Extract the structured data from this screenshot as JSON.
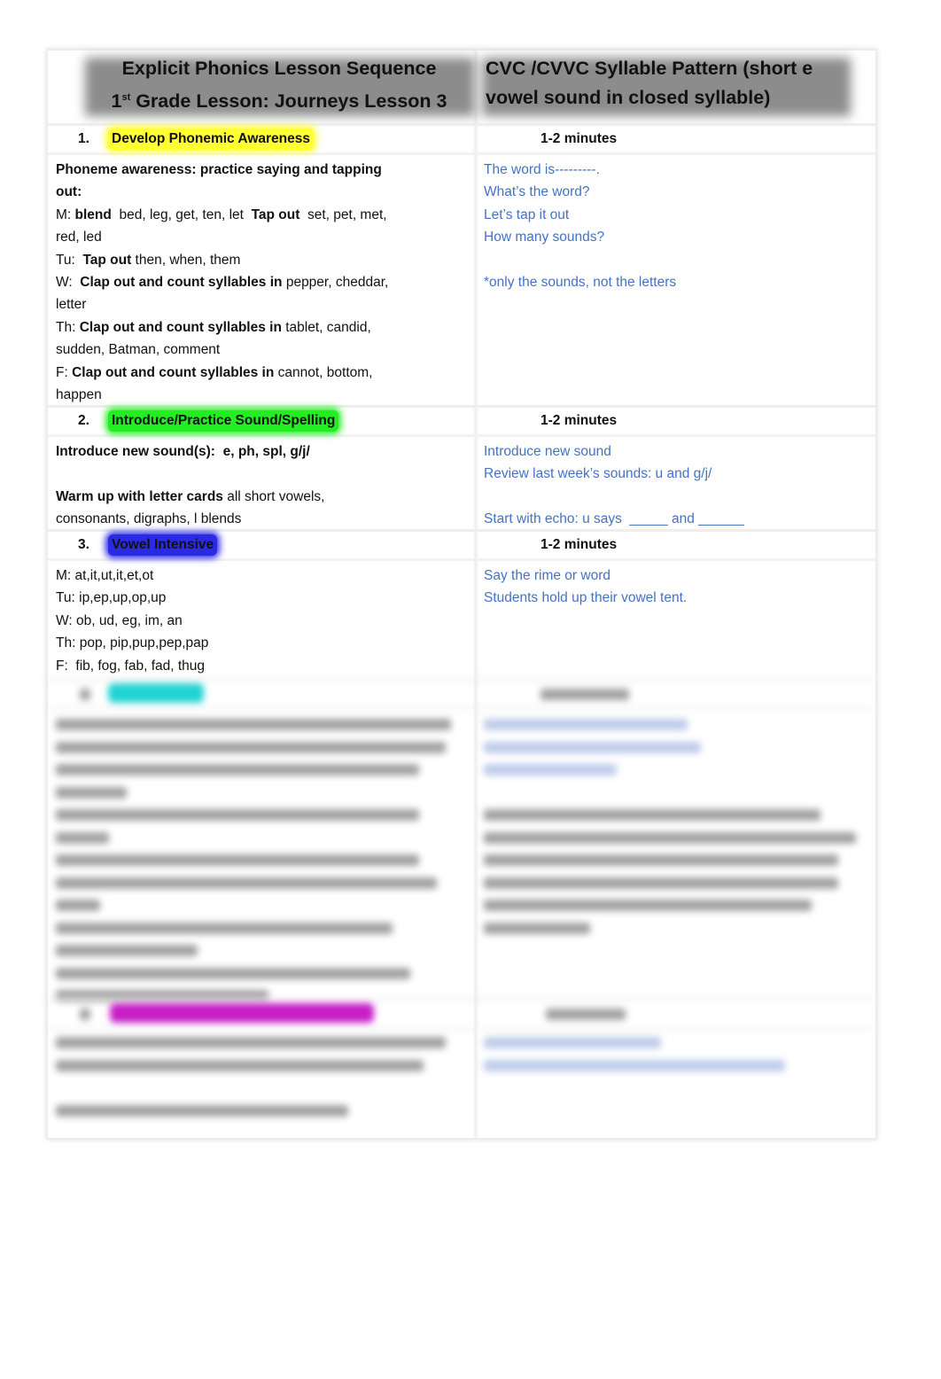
{
  "header": {
    "left_line1": "Explicit Phonics Lesson Sequence",
    "left_line2_num": "1",
    "left_line2_sup": "st",
    "left_line2_rest": " Grade Lesson: Journeys Lesson 3",
    "right_line1": "CVC /CVVC Syllable Pattern (short e",
    "right_line2": "vowel sound in closed syllable)"
  },
  "sections": [
    {
      "number": "1.",
      "title": "Develop Phonemic Awareness",
      "highlight": "#ffff33",
      "time": "1-2 minutes",
      "left_lines": [
        [
          {
            "t": "Phoneme awareness: practice saying and tapping",
            "b": true
          }
        ],
        [
          {
            "t": "out:",
            "b": true
          }
        ],
        [
          {
            "t": "M: "
          },
          {
            "t": "blend",
            "b": true
          },
          {
            "t": "  bed, leg, get, ten, let  "
          },
          {
            "t": "Tap out",
            "b": true
          },
          {
            "t": "  set, pet, met,"
          }
        ],
        [
          {
            "t": "red, led"
          }
        ],
        [
          {
            "t": "Tu:  "
          },
          {
            "t": "Tap out",
            "b": true
          },
          {
            "t": " then, when, them"
          }
        ],
        [
          {
            "t": "W:  "
          },
          {
            "t": "Clap out and count syllables in",
            "b": true
          },
          {
            "t": " pepper, cheddar,"
          }
        ],
        [
          {
            "t": "letter"
          }
        ],
        [
          {
            "t": "Th: "
          },
          {
            "t": "Clap out and count syllables in",
            "b": true
          },
          {
            "t": " tablet, candid,"
          }
        ],
        [
          {
            "t": "sudden, Batman, comment"
          }
        ],
        [
          {
            "t": "F: "
          },
          {
            "t": "Clap out and count syllables in",
            "b": true
          },
          {
            "t": " cannot, bottom,"
          }
        ],
        [
          {
            "t": "happen"
          }
        ]
      ],
      "right_lines": [
        "The word is---------.",
        "What’s the word?",
        "Let’s tap it out",
        "How many sounds?",
        "",
        "*only the sounds, not the letters"
      ]
    },
    {
      "number": "2.",
      "title": "Introduce/Practice Sound/Spelling",
      "highlight": "#22ee22",
      "time": "1-2 minutes",
      "left_lines": [
        [
          {
            "t": "Introduce new sound(s):  e, ph, spl, g/j/",
            "b": true
          }
        ],
        [],
        [
          {
            "t": "Warm up with letter cards",
            "b": true
          },
          {
            "t": " all short vowels,"
          }
        ],
        [
          {
            "t": "consonants, digraphs, l blends"
          }
        ]
      ],
      "right_lines": [
        "Introduce new sound",
        "Review last week’s sounds: u and g/j/",
        "",
        "Start with echo: u says  _____ and ______"
      ]
    },
    {
      "number": "3.",
      "title": "Vowel Intensive",
      "highlight": "#2a2ae6",
      "time": "1-2 minutes",
      "left_lines": [
        [
          {
            "t": "M: at,it,ut,it,et,ot"
          }
        ],
        [
          {
            "t": "Tu: ip,ep,up,op,up"
          }
        ],
        [
          {
            "t": "W: ob, ud, eg, im, an"
          }
        ],
        [
          {
            "t": "Th: pop, pip,pup,pep,pap"
          }
        ],
        [
          {
            "t": "F:  fib, fog, fab, fad, thug"
          }
        ]
      ],
      "right_lines": [
        "Say the rime or word",
        "Students hold up their vowel tent."
      ]
    }
  ],
  "blurred_sections": [
    {
      "highlight": "#22d3d3"
    },
    {
      "highlight": "#c81ec8"
    }
  ]
}
